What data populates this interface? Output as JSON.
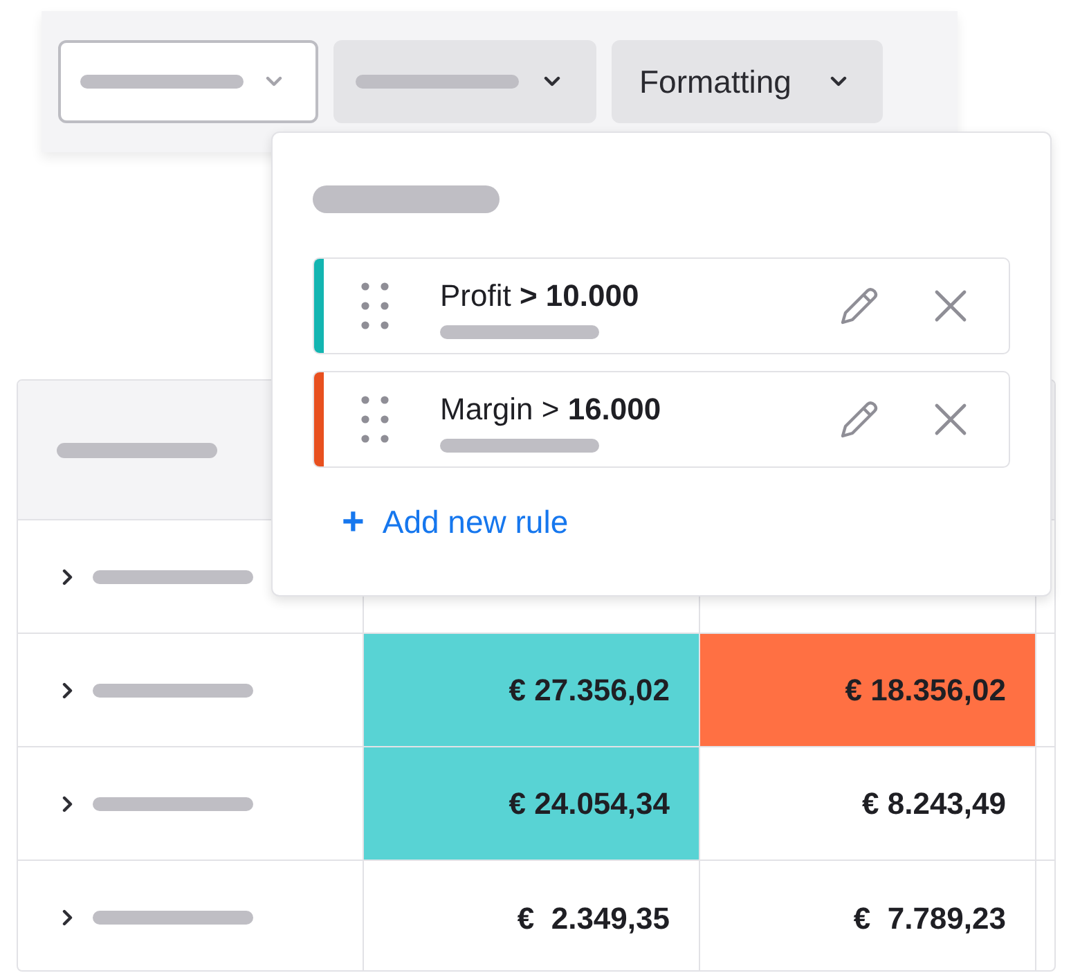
{
  "toolbar": {
    "dropdowns": [
      {
        "selected": true
      },
      {
        "selected": false
      },
      {
        "label": "Formatting",
        "selected": false
      }
    ]
  },
  "formatting_menu": {
    "rules": [
      {
        "text": "Profit **> 10.000**",
        "color": "#13b5b1"
      },
      {
        "text": "Margin > **16.000**",
        "color": "#e8501f"
      }
    ],
    "add_link": {
      "icon": "+",
      "label": "Add new rule"
    }
  },
  "table": {
    "rows": [
      {
        "expanded": false,
        "cells": []
      },
      {
        "expanded": false,
        "cells": [
          {
            "text": "€ 27.356,02",
            "color": "#58d3d4"
          },
          {
            "text": "€ 18.356,02",
            "color": "#ff7043"
          }
        ]
      },
      {
        "expanded": false,
        "cells": [
          {
            "text": "€ 24.054,34",
            "color": "#58d3d4"
          },
          {
            "text": "€ 8.243,49"
          }
        ]
      },
      {
        "expanded": false,
        "cells": [
          {
            "text": "€  2.349,35"
          },
          {
            "text": "€  7.789,23"
          }
        ]
      }
    ]
  }
}
